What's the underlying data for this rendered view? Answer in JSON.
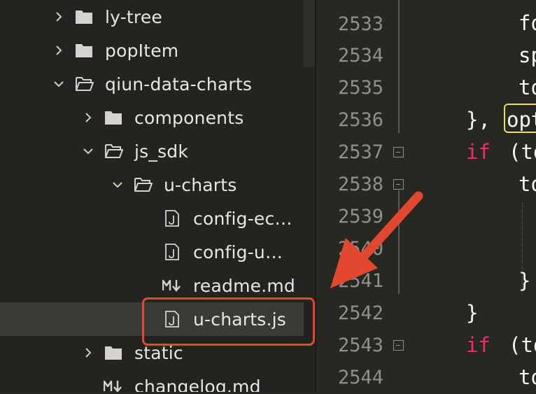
{
  "sidebar": {
    "items": [
      {
        "label": "ly-tree",
        "type": "folder",
        "expanded": false,
        "depth": 0
      },
      {
        "label": "popItem",
        "type": "folder",
        "expanded": false,
        "depth": 0
      },
      {
        "label": "qiun-data-charts",
        "type": "folder",
        "expanded": true,
        "depth": 0
      },
      {
        "label": "components",
        "type": "folder",
        "expanded": false,
        "depth": 1
      },
      {
        "label": "js_sdk",
        "type": "folder",
        "expanded": true,
        "depth": 1
      },
      {
        "label": "u-charts",
        "type": "folder",
        "expanded": true,
        "depth": 2
      },
      {
        "label": "config-ec…",
        "type": "js-file",
        "depth": 3
      },
      {
        "label": "config-u…",
        "type": "js-file",
        "depth": 3
      },
      {
        "label": "readme.md",
        "type": "md-file",
        "depth": 3
      },
      {
        "label": "u-charts.js",
        "type": "js-file",
        "depth": 3,
        "selected": true
      },
      {
        "label": "static",
        "type": "folder",
        "expanded": false,
        "depth": 1
      },
      {
        "label": "changelog.md",
        "type": "md-file",
        "depth": 1
      }
    ]
  },
  "editor": {
    "line_numbers": [
      "2533",
      "2534",
      "2535",
      "2536",
      "2537",
      "2538",
      "2539",
      "2540",
      "2541",
      "2542",
      "2543",
      "2544"
    ],
    "code": {
      "l2533": "fo",
      "l2534": "sp",
      "l2535": "to",
      "l2536_a": "},",
      "l2536_b": "opt",
      "l2537_kw": "if",
      "l2537_rest": "(to",
      "l2538": "to",
      "l2541": "}",
      "l2542": "}",
      "l2543_kw": "if",
      "l2543_rest": "(to",
      "l2544": "to"
    }
  },
  "colors": {
    "annotation": "#e2472f",
    "keyword": "#f92672",
    "bracket_highlight": "#e6db74"
  }
}
